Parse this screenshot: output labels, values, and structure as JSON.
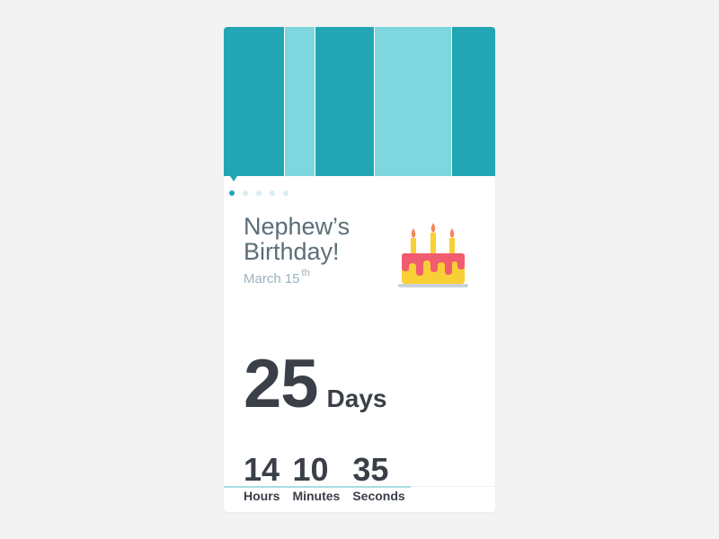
{
  "event": {
    "title": "Nephew’s Birthday!",
    "date_main": "March 15",
    "date_suffix": "th",
    "icon": "birthday-cake-icon"
  },
  "carousel": {
    "total": 5,
    "active_index": 0
  },
  "countdown": {
    "days": {
      "value": "25",
      "label": "Days"
    },
    "hours": {
      "value": "14",
      "label": "Hours"
    },
    "minutes": {
      "value": "10",
      "label": "Minutes"
    },
    "seconds": {
      "value": "35",
      "label": "Seconds"
    }
  },
  "progress": {
    "fraction": 0.69
  },
  "colors": {
    "accent_dark": "#22a6b3",
    "accent_light": "#7ed6df",
    "text_dark": "#3a3f48",
    "text_muted": "#5b6e77",
    "cake_pink": "#f25c70",
    "cake_yellow": "#f9cf36",
    "flame": "#f08a5d"
  }
}
